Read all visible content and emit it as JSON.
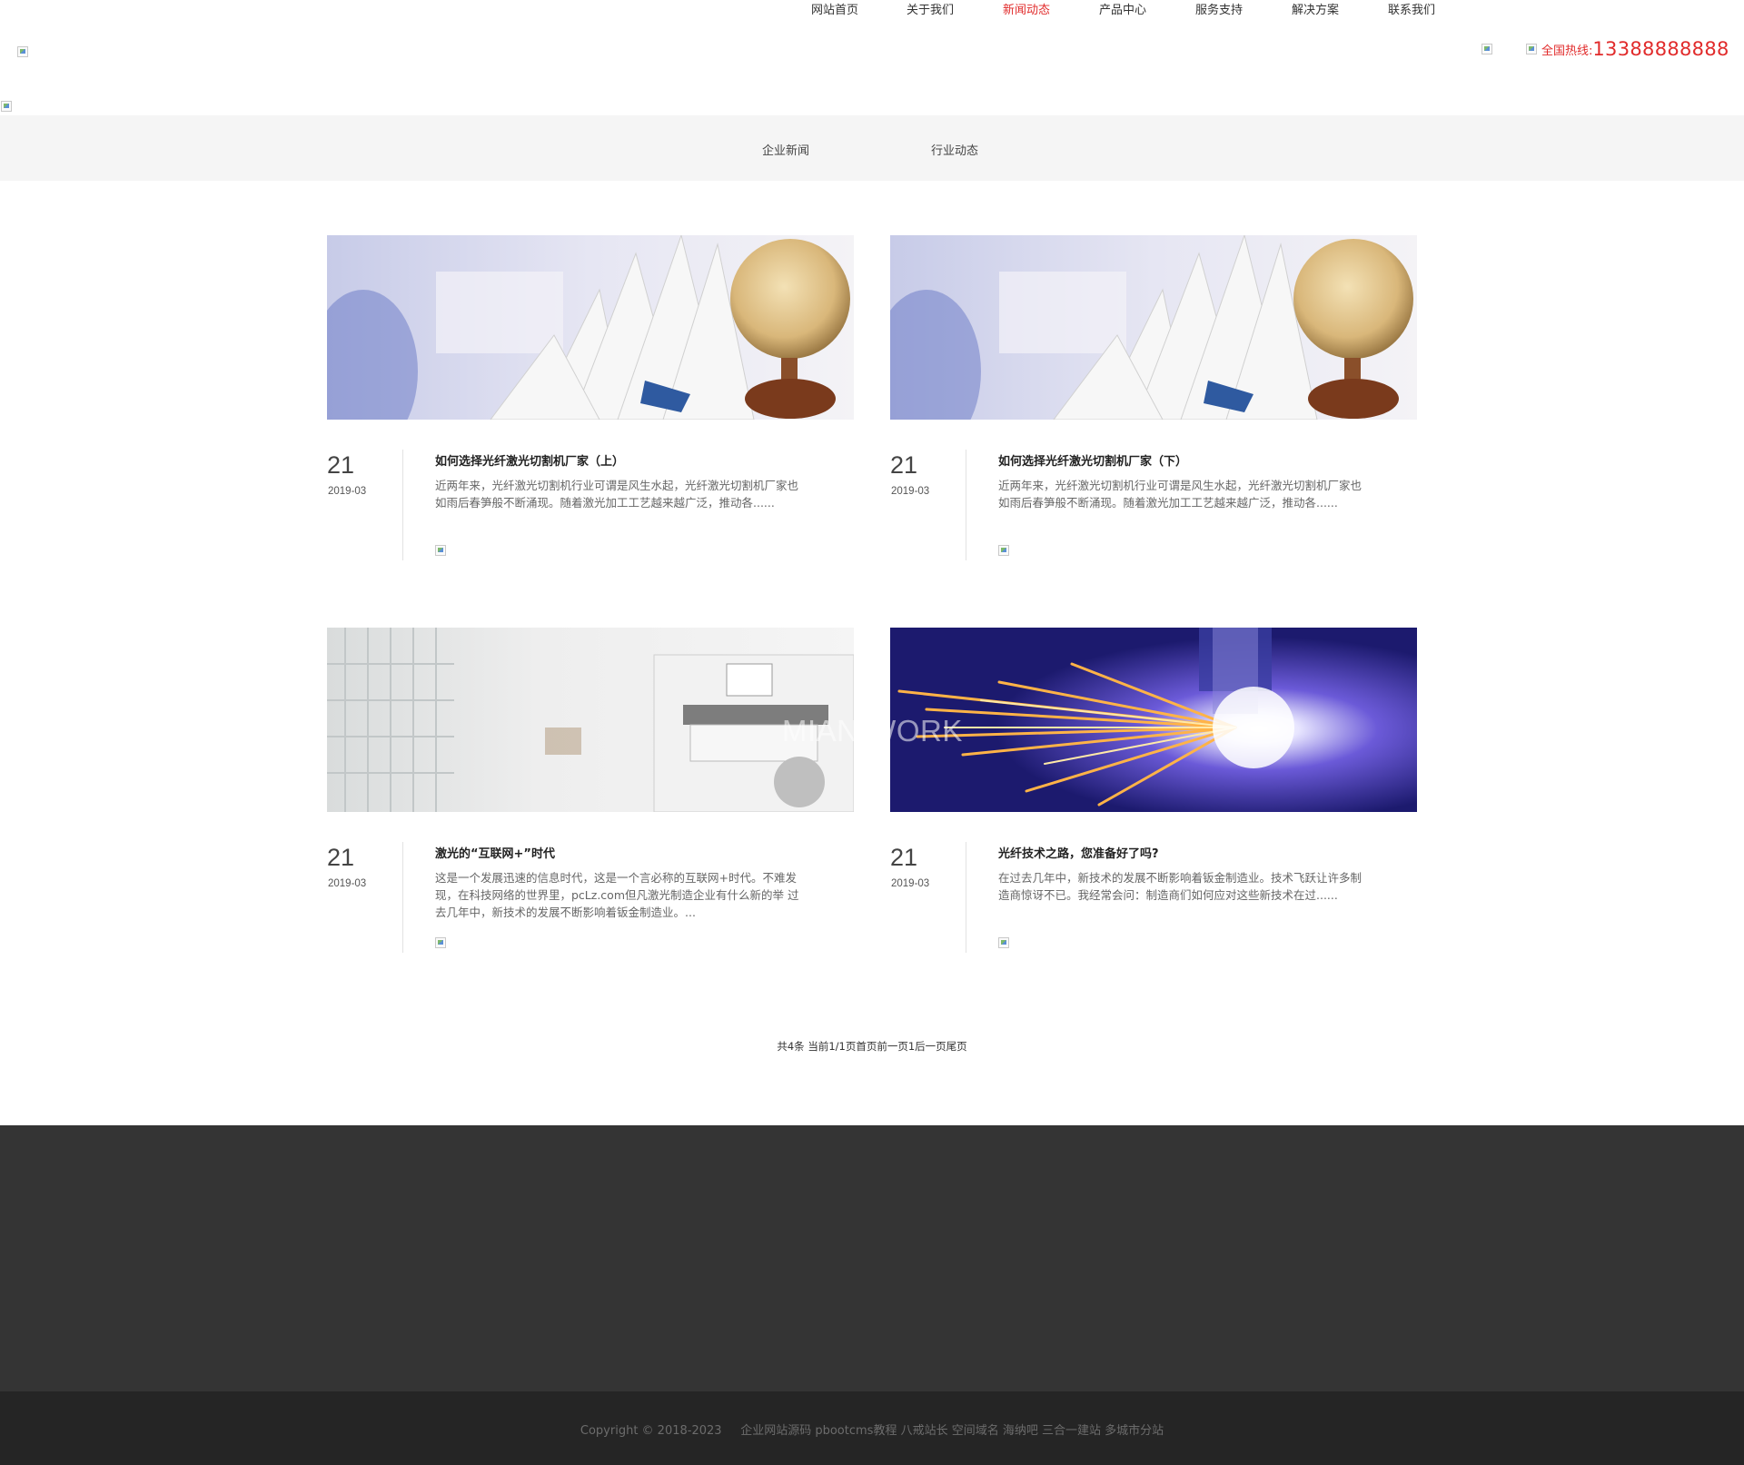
{
  "header": {
    "nav": [
      {
        "label": "网站首页",
        "active": false
      },
      {
        "label": "关于我们",
        "active": false
      },
      {
        "label": "新闻动态",
        "active": true
      },
      {
        "label": "产品中心",
        "active": false
      },
      {
        "label": "服务支持",
        "active": false
      },
      {
        "label": "解决方案",
        "active": false
      },
      {
        "label": "联系我们",
        "active": false
      }
    ],
    "hotline_label": "全国热线:",
    "hotline_number": "13388888888"
  },
  "subnav": [
    "企业新闻",
    "行业动态"
  ],
  "news": [
    {
      "day": "21",
      "ym": "2019-03",
      "title": "如何选择光纤激光切割机厂家（上）",
      "desc": "近两年来，光纤激光切割机行业可谓是风生水起，光纤激光切割机厂家也如雨后春笋般不断涌现。随着激光加工工艺越来越广泛，推动各......",
      "image": "newspaper-globe"
    },
    {
      "day": "21",
      "ym": "2019-03",
      "title": "如何选择光纤激光切割机厂家（下）",
      "desc": "近两年来，光纤激光切割机行业可谓是风生水起，光纤激光切割机厂家也如雨后春笋般不断涌现。随着激光加工工艺越来越广泛，推动各......",
      "image": "newspaper-globe"
    },
    {
      "day": "21",
      "ym": "2019-03",
      "title": "激光的“互联网+”时代",
      "desc": "这是一个发展迅速的信息时代，这是一个言必称的互联网+时代。不难发现，在科技网络的世界里，pcLz.com但凡激光制造企业有什么新的举 过去几年中，新技术的发展不断影响着钣金制造业。...",
      "image": "white-lab"
    },
    {
      "day": "21",
      "ym": "2019-03",
      "title": "光纤技术之路，您准备好了吗?",
      "desc": "在过去几年中，新技术的发展不断影响着钣金制造业。技术飞跃让许多制造商惊讶不已。我经常会问：制造商们如何应对这些新技术在过......",
      "image": "laser-sparks"
    }
  ],
  "watermark": "MIAN.WORK",
  "pager": {
    "summary": "共4条 当前1/1页",
    "first": "首页",
    "prev": "前一页",
    "page": "1",
    "next": "后一页",
    "last": "尾页"
  },
  "footer": {
    "copyright": "Copyright © 2018-2023",
    "links": "企业网站源码 pbootcms教程 八戒站长 空间域名 海纳吧 三合一建站 多城市分站"
  },
  "colors": {
    "accent": "#e12b2b",
    "subnav_bg": "#f5f5f5",
    "footer_bg": "#343434",
    "copyright_bg": "#252525"
  }
}
